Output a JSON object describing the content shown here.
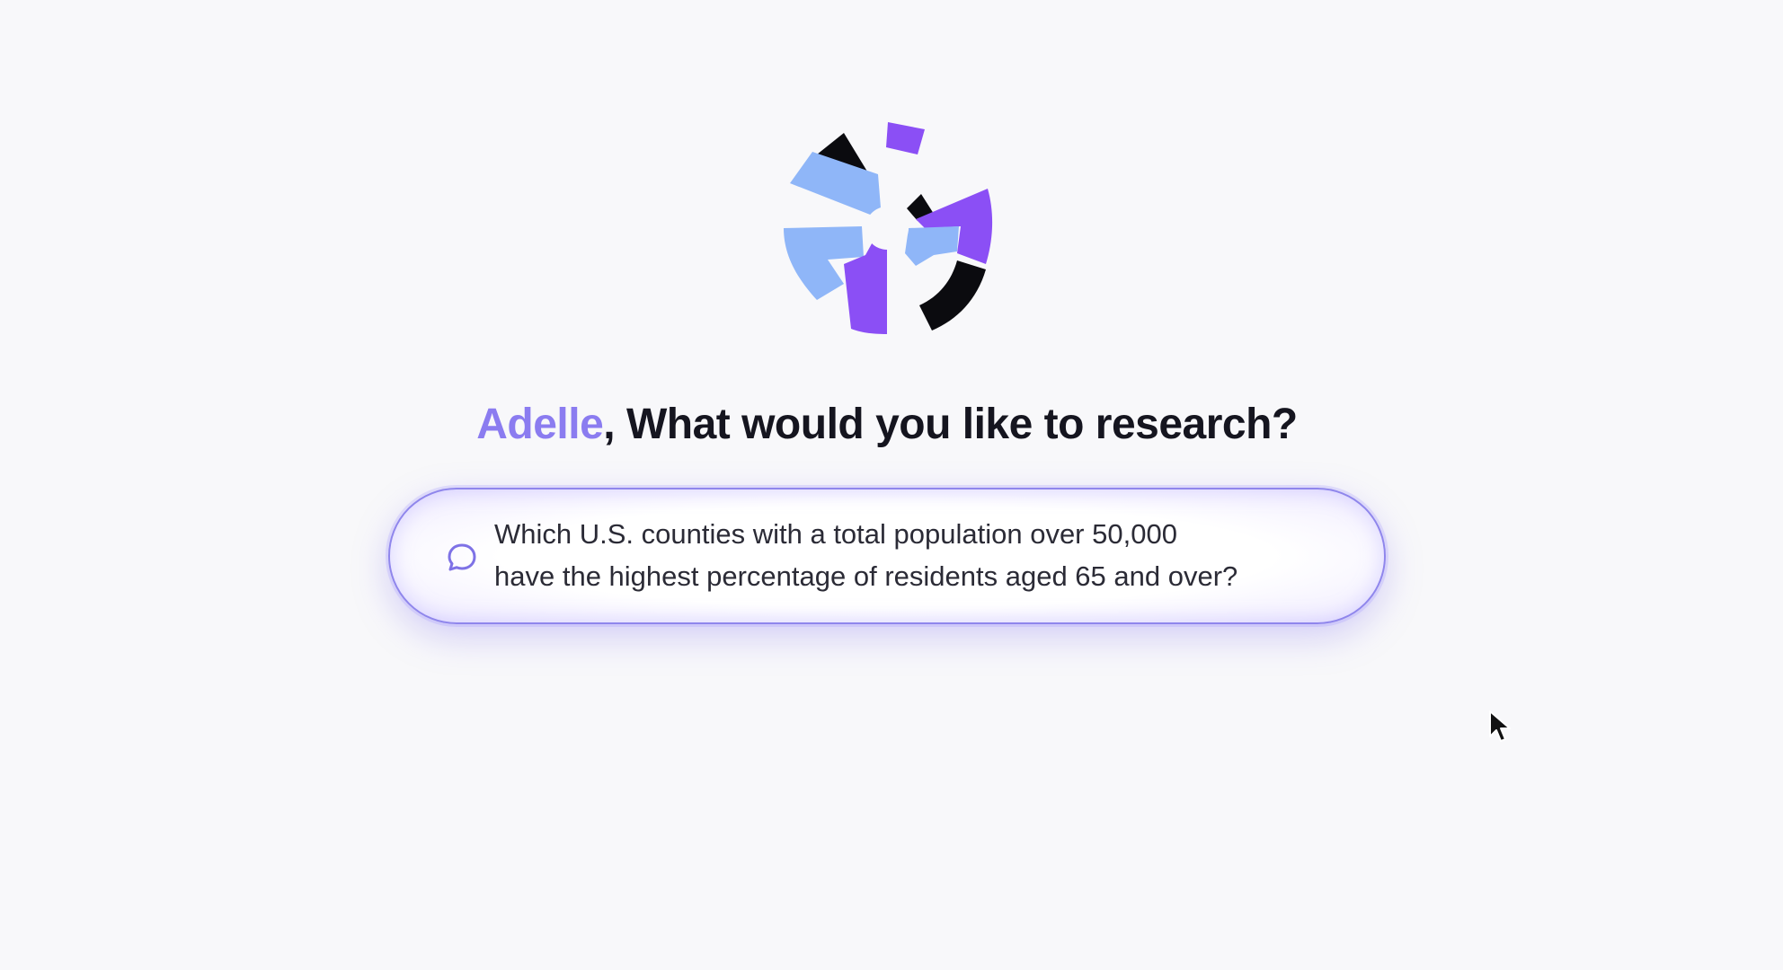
{
  "brand": {
    "logo_icon": "segmented-ring-logo",
    "colors": {
      "purple": "#8b4ff5",
      "light_blue": "#8fb6f8",
      "black": "#0b0b0f",
      "accent_name": "#8b7cf0",
      "heading": "#15151f"
    }
  },
  "heading": {
    "user_name": "Adelle",
    "question": ", What would you like to research?"
  },
  "prompt": {
    "icon": "chat-bubble-icon",
    "text": "Which U.S. counties with a total population over 50,000\nhave the highest percentage of residents aged 65 and over?"
  },
  "cursor": {
    "icon": "mouse-pointer-icon"
  }
}
